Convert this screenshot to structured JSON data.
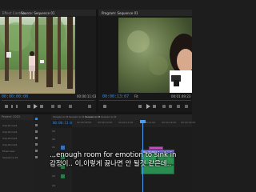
{
  "source_monitor": {
    "tabs": [
      "Effect Controls",
      "Source: Sequence 01"
    ],
    "timecode_left": "00:00:00:00",
    "timecode_right": "00:00:11:03"
  },
  "program_monitor": {
    "tab": "Program: Sequence 01",
    "timecode_left": "00:00:13:07",
    "fit_label": "Fit",
    "timecode_right": "00:01:49:23"
  },
  "timeline": {
    "tabs": [
      "Sequence 01",
      "Sequence 01",
      "Sequence 01",
      "Sequence 01"
    ],
    "timecode": "00:00:13:07",
    "ruler_labels": [
      "00:00:08:00",
      "00:00:10:00",
      "00:00:12:00",
      "00:00:14:00",
      "00:00:16:00",
      "00:00:18:00"
    ],
    "track_labels": [
      "V3",
      "V2",
      "V1",
      "A1",
      "A2",
      "A3",
      "A4"
    ],
    "clip_label": "Clip-02.mp4"
  },
  "project_panel": {
    "title": "Project: 2022",
    "items": [
      "Clip-01.mp4",
      "Clip-02.mp4",
      "Clip-03.mp4",
      "Clip-04.mp4",
      "Music.wav",
      "Sequence 01"
    ]
  },
  "subtitles": {
    "english": "...enough room for emotion to sink in",
    "korean": "감정이.. 이,이렇게 끓나면 안 될것 같은데.."
  },
  "colors": {
    "accent": "#2d8ceb",
    "playhead": "#4a9ff0",
    "video_clip": "#7b79d6",
    "audio_clip": "#2d9d5a",
    "subtitle_clip": "#c24fc2"
  }
}
